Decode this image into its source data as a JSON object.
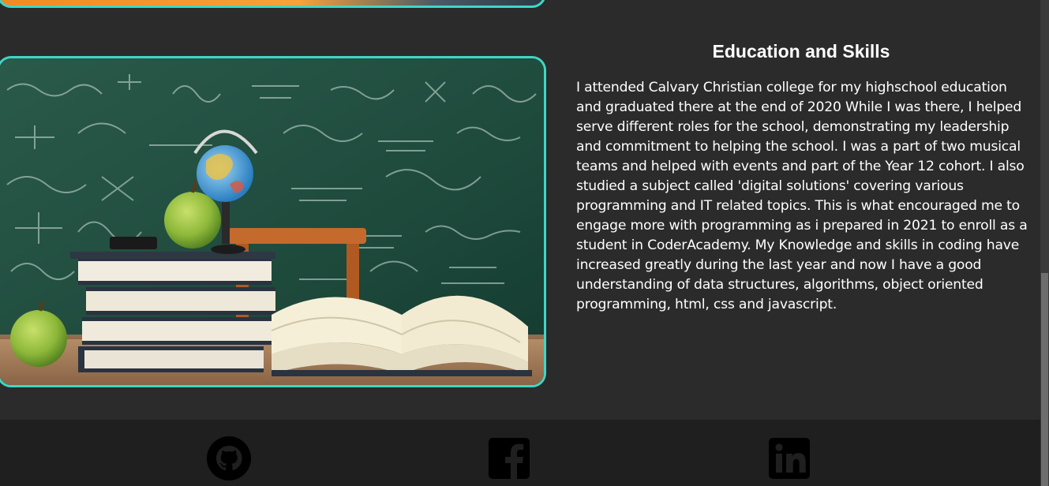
{
  "education": {
    "title": "Education and Skills",
    "paragraph": "I attended Calvary Christian college for my highschool education and graduated there at the end of 2020 While I was there, I helped serve different roles for the school, demonstrating my leadership and commitment to helping the school. I was a part of two musical teams and helped with events and part of the Year 12 cohort. I also studied a subject called 'digital solutions' covering various programming and IT related topics. This is what encouraged me to engage more with programming as i prepared in 2021 to enroll as a student in CoderAcademy. My Knowledge and skills in coding have increased greatly during the last year and now I have a good understanding of data structures, algorithms, object oriented programming, html, css and javascript.",
    "image_alt": "books, apples and globe in front of a chalkboard"
  },
  "footer": {
    "social_links": [
      {
        "icon": "github-icon",
        "label": "GitHub"
      },
      {
        "icon": "facebook-icon",
        "label": "Facebook"
      },
      {
        "icon": "linkedin-icon",
        "label": "LinkedIn"
      }
    ]
  },
  "colors": {
    "background": "#2b2b2b",
    "accent_border": "#3fd6c6",
    "footer_bg": "#1f1f1f",
    "text": "#ffffff"
  }
}
